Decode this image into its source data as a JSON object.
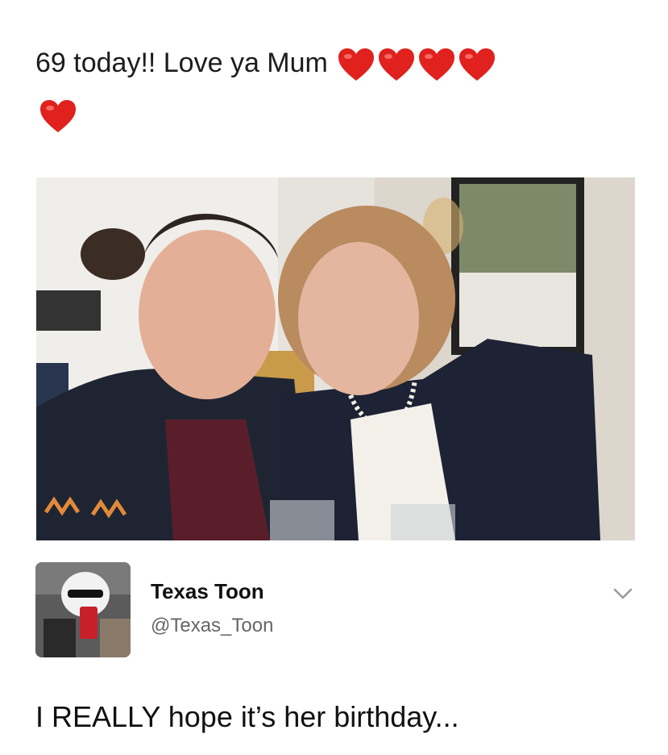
{
  "post": {
    "caption": "69 today!! Love ya Mum",
    "hearts": [
      "heart-emoji",
      "heart-emoji",
      "heart-emoji",
      "heart-emoji",
      "heart-emoji"
    ],
    "heart_color": "#e0211d"
  },
  "tweet": {
    "author_name": "Texas Toon",
    "author_handle": "@Texas_Toon",
    "text": "I REALLY hope it’s her birthday...",
    "menu_icon": "chevron-down-icon"
  }
}
